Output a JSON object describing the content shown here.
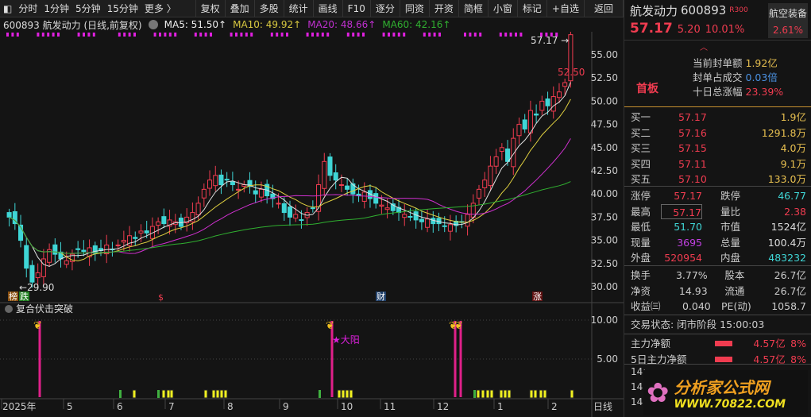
{
  "toolbar": {
    "items": [
      "分时",
      "1分钟",
      "5分钟",
      "15分钟",
      "更多 〉"
    ],
    "buttons": [
      "复权",
      "叠加",
      "多股",
      "统计",
      "画线",
      "F10",
      "逐分",
      "同资",
      "开资",
      "简框",
      "小窗",
      "标记",
      "+自选",
      "返回"
    ]
  },
  "info": {
    "code_name": "600893 航发动力 (日线,前复权)",
    "ma5": "MA5: 51.50↑",
    "ma10": "MA10: 49.92↑",
    "ma20": "MA20: 48.66↑",
    "ma60": "MA60: 42.16↑"
  },
  "chart_data": {
    "type": "candlestick",
    "title": "600893 航发动力 (日线,前复权)",
    "closes": [
      37.5,
      36.8,
      35,
      32,
      30.5,
      31.5,
      33,
      34,
      33.5,
      33,
      32.8,
      33.5,
      34,
      33.8,
      34.2,
      33.6,
      33.9,
      34.5,
      34,
      34.5,
      35,
      35.5,
      35.2,
      36,
      35.8,
      36.5,
      37,
      36.8,
      37.2,
      37,
      36.5,
      37.5,
      38,
      39,
      40.5,
      41.5,
      42,
      41,
      41.5,
      41,
      40.5,
      41,
      40.8,
      40,
      40.5,
      39.8,
      39.5,
      39,
      38,
      37.5,
      37.8,
      37.2,
      38,
      38.5,
      41,
      43.5,
      42,
      41.5,
      41,
      40.5,
      40,
      39.8,
      40.2,
      39.5,
      39,
      38.8,
      38.5,
      38.2,
      38,
      37.8,
      37.5,
      37.2,
      37,
      37.3,
      36.8,
      36.8,
      36.5,
      36.7,
      36.6,
      37,
      37.8,
      39,
      40.5,
      41.5,
      43,
      44,
      45,
      43.5,
      46,
      47.5,
      47,
      49,
      48.5,
      50,
      49.5,
      50.5,
      51,
      52,
      57.17
    ],
    "ylim": [
      28.5,
      57.5
    ],
    "yticks": [
      "55.00",
      "52.50",
      "50.00",
      "47.50",
      "45.00",
      "42.50",
      "40.00",
      "37.50",
      "35.00",
      "32.50",
      "30.00"
    ],
    "xticks": [
      "2025年",
      "5",
      "6",
      "7",
      "8",
      "9",
      "10",
      "11",
      "12",
      "1",
      "2"
    ],
    "annotations": {
      "high": "57.17",
      "low": "29.90",
      "prev": "52.50"
    },
    "events": [
      "榜",
      "跌",
      "$",
      "财",
      "涨"
    ],
    "indicator": {
      "name": "复合伏击突破",
      "yticks": [
        "10.00",
        "5.00"
      ],
      "signal_label": "★大阳",
      "signals": [
        6,
        56,
        77,
        78
      ]
    },
    "period": "日线"
  },
  "panel": {
    "name": "航发动力",
    "code": "600893",
    "tag": "R300",
    "sector": "航空装备",
    "sector_chg": "2.61%",
    "price": "57.17",
    "chg": "5.20",
    "pct": "10.01%",
    "board": "首板",
    "seal": [
      [
        "当前封单额",
        "1.92亿"
      ],
      [
        "封单占成交",
        "0.03倍"
      ],
      [
        "十日总涨幅",
        "23.39%"
      ]
    ],
    "bids": [
      [
        "买一",
        "57.17",
        "1.9亿"
      ],
      [
        "买二",
        "57.16",
        "1291.8万"
      ],
      [
        "买三",
        "57.15",
        "4.0万"
      ],
      [
        "买四",
        "57.11",
        "9.1万"
      ],
      [
        "买五",
        "57.10",
        "133.0万"
      ]
    ],
    "stats": [
      [
        "涨停",
        "57.17",
        "跌停",
        "46.77"
      ],
      [
        "最高",
        "57.17",
        "量比",
        "2.38"
      ],
      [
        "最低",
        "51.70",
        "市值",
        "1524亿"
      ],
      [
        "现量",
        "3695",
        "总量",
        "100.4万"
      ],
      [
        "外盘",
        "520954",
        "内盘",
        "483232"
      ]
    ],
    "stats2": [
      [
        "换手",
        "3.77%",
        "股本",
        "26.7亿"
      ],
      [
        "净资",
        "14.93",
        "流通",
        "26.7亿"
      ],
      [
        "收益㈢",
        "0.040",
        "PE(动)",
        "1058.7"
      ]
    ],
    "status": "交易状态: 闭市阶段 15:00:03",
    "flow": [
      [
        "主力净额",
        "4.57亿",
        "8%"
      ],
      [
        "5日主力净额",
        "4.57亿",
        "8%"
      ]
    ],
    "ticks": [
      "14:",
      "14:",
      "14:"
    ],
    "logo_cn": "分析家公式网",
    "logo_url": "WWW.70822.COM"
  },
  "colors": {
    "up": "#f03c50",
    "down": "#3fd6d6",
    "ma5": "#e0e0e0",
    "ma10": "#e0d040",
    "ma20": "#d030d0",
    "ma60": "#30b030"
  }
}
